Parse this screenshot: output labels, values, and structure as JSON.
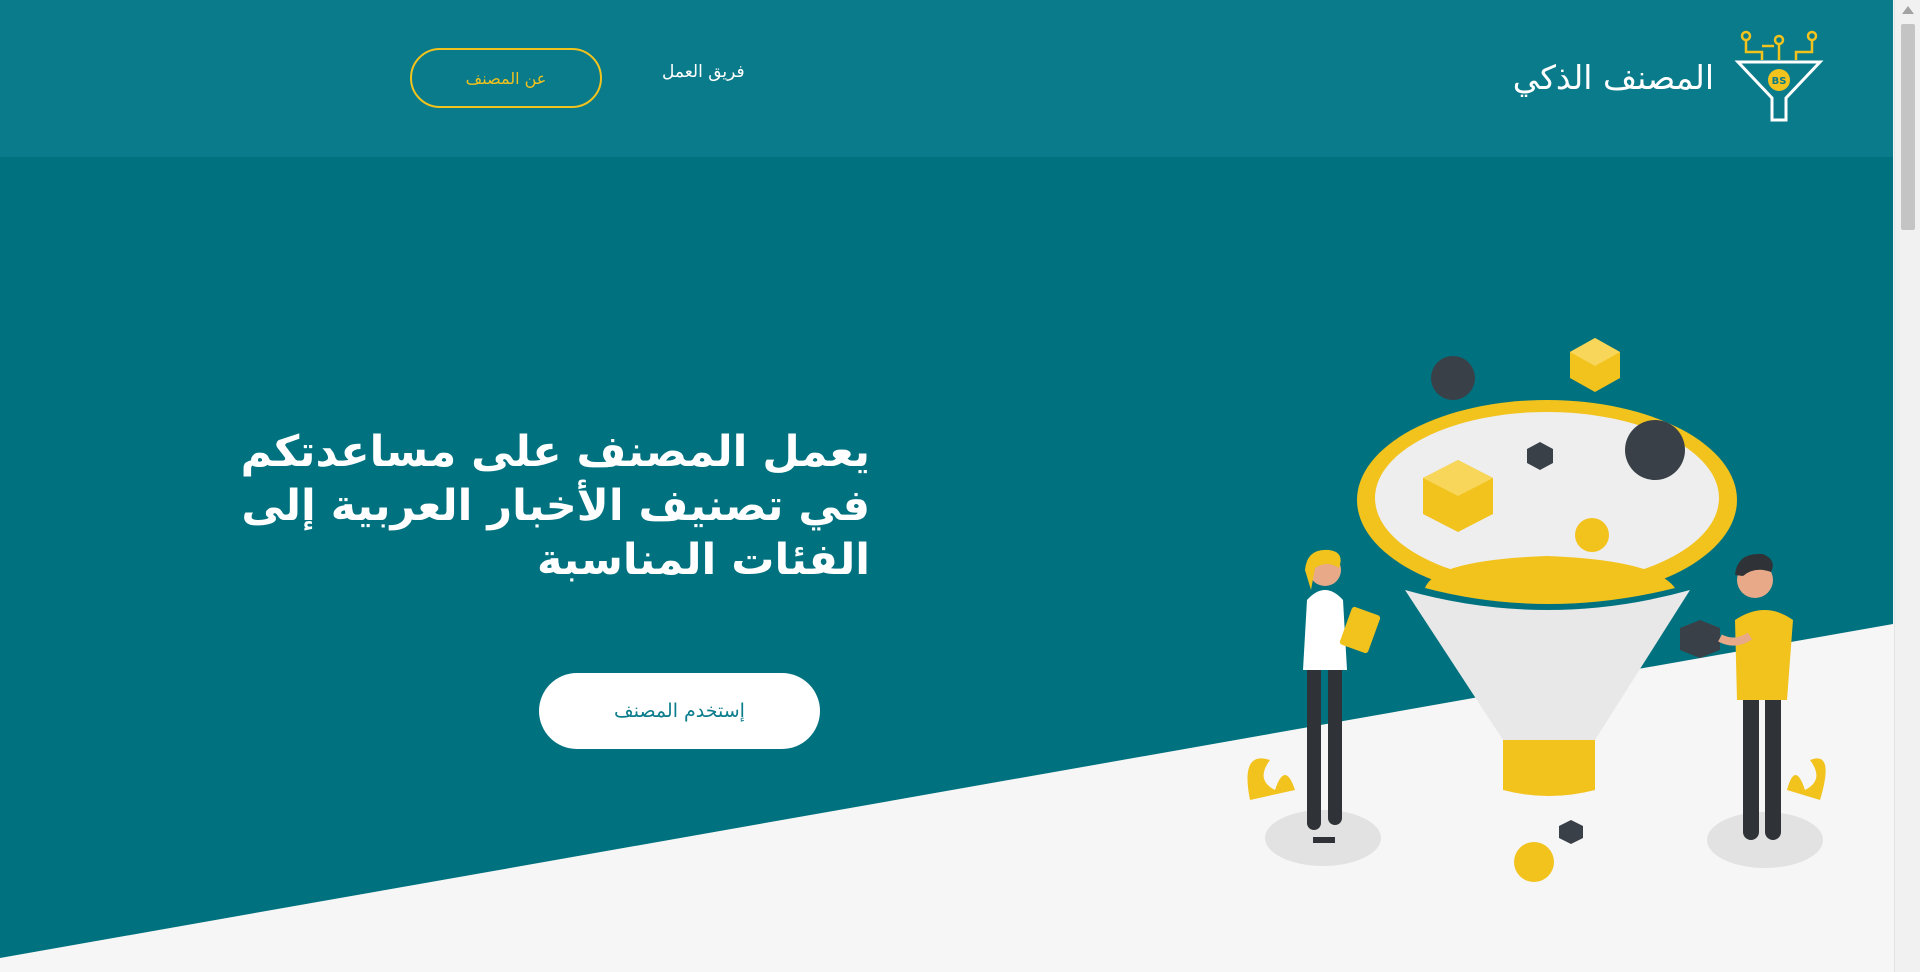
{
  "brand": {
    "name": "المصنف الذكي",
    "logo_text": "BS",
    "logo_icon": "funnel-logo-icon"
  },
  "nav": {
    "team_label": "فريق العمل",
    "about_label": "عن المصنف"
  },
  "hero": {
    "title": "يعمل المصنف على مساعدتكم في تصنيف الأخبار العربية إلى الفئات المناسبة",
    "cta_label": "إستخدم المصنف"
  },
  "colors": {
    "teal": "#0a7b8a",
    "teal_dark": "#00727f",
    "yellow": "#f2c21d",
    "white": "#ffffff",
    "light_gray": "#f6f6f6",
    "dark_shape": "#3a4048"
  }
}
